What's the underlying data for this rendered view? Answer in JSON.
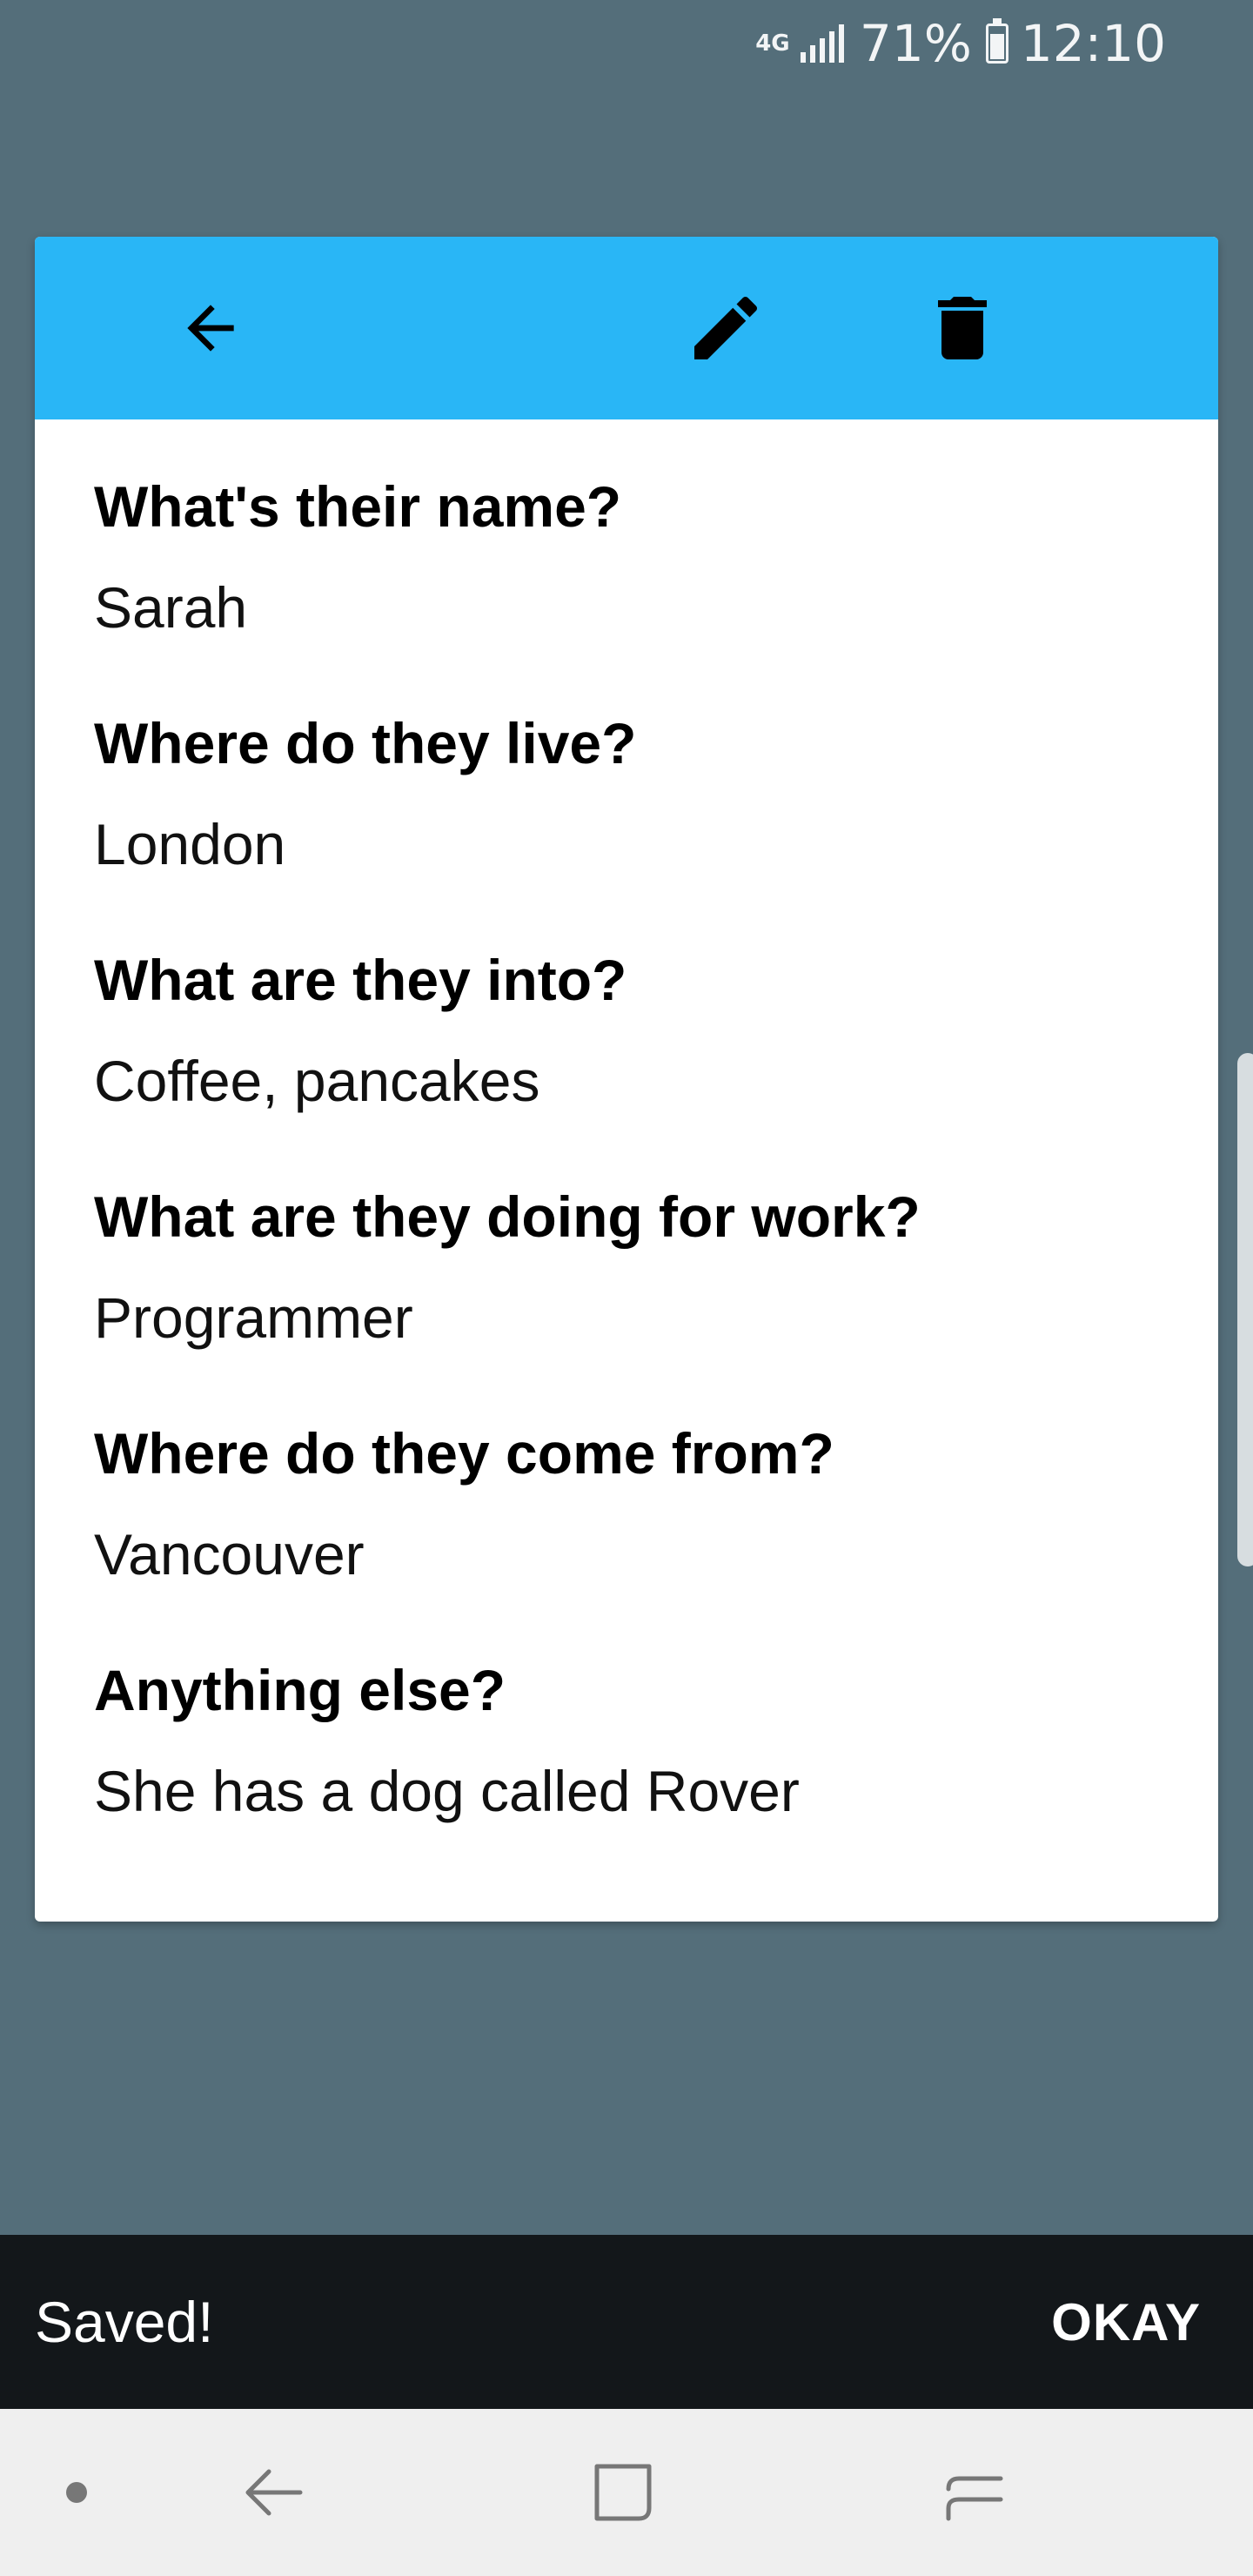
{
  "status_bar": {
    "network": "4G",
    "battery_percent": "71%",
    "time": "12:10"
  },
  "toolbar": {
    "back_icon": "arrow-left-icon",
    "edit_icon": "pencil-icon",
    "delete_icon": "trash-icon",
    "color": "#29b6f6"
  },
  "fields": [
    {
      "question": "What's their name?",
      "answer": "Sarah"
    },
    {
      "question": "Where do they live?",
      "answer": "London"
    },
    {
      "question": "What are they into?",
      "answer": "Coffee, pancakes"
    },
    {
      "question": "What are they doing for work?",
      "answer": "Programmer"
    },
    {
      "question": "Where do they come from?",
      "answer": "Vancouver"
    },
    {
      "question": "Anything else?",
      "answer": "She has a dog called Rover"
    }
  ],
  "snackbar": {
    "message": "Saved!",
    "action": "OKAY"
  },
  "navbar": {
    "dot_icon": "dot-icon",
    "back_icon": "nav-back-icon",
    "home_icon": "nav-home-icon",
    "recents_icon": "nav-recents-icon"
  },
  "colors": {
    "background": "#546e7a",
    "toolbar": "#29b6f6",
    "snackbar": "#13171a",
    "navbar": "#efefef"
  }
}
